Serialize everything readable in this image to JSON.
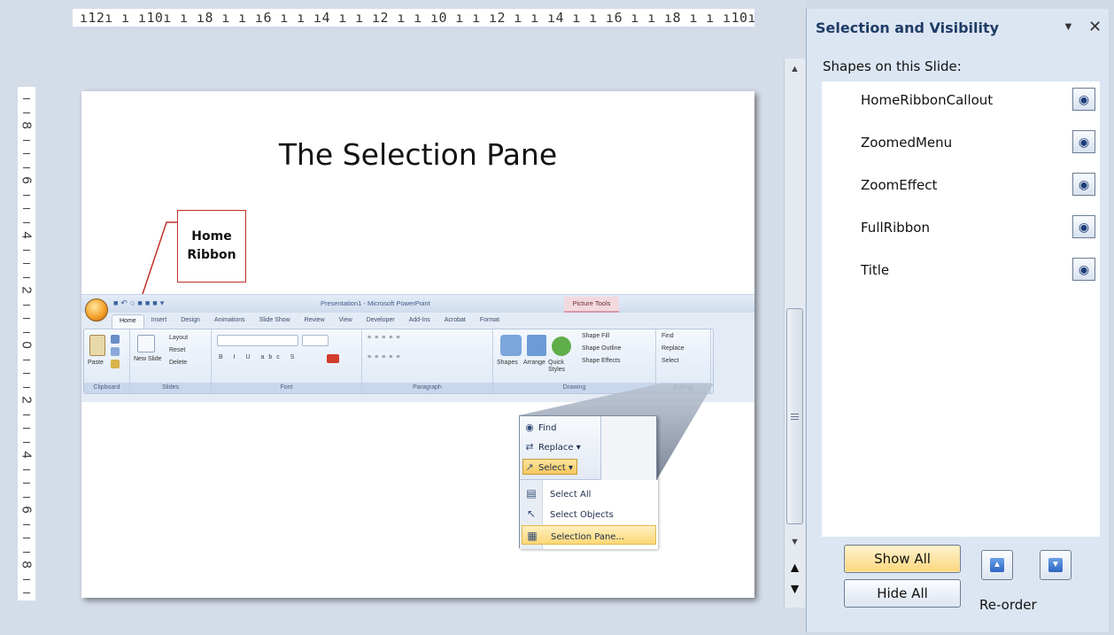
{
  "ruler": {
    "horizontal": "ı12ı ı ı10ı ı ı8 ı ı ı6 ı ı ı4 ı ı ı2 ı ı ı0 ı ı ı2 ı ı ı4 ı ı ı6 ı ı ı8 ı ı ı10ı ı ı12ı",
    "vertical_numbers": [
      "8",
      "6",
      "4",
      "2",
      "0",
      "2",
      "4",
      "6",
      "8"
    ]
  },
  "slide": {
    "title": "The Selection Pane",
    "callout": "Home Ribbon"
  },
  "ribbon": {
    "app_title": "Presentation1 - Microsoft PowerPoint",
    "contextual_tab": "Picture Tools",
    "tabs": [
      "Home",
      "Insert",
      "Design",
      "Animations",
      "Slide Show",
      "Review",
      "View",
      "Developer",
      "Add-Ins",
      "Acrobat",
      "Format"
    ],
    "groups": [
      "Clipboard",
      "Slides",
      "Font",
      "Paragraph",
      "Drawing",
      "Editing"
    ],
    "paste": "Paste",
    "new_slide": "New Slide",
    "layout": "Layout",
    "reset": "Reset",
    "delete": "Delete",
    "shapes": "Shapes",
    "arrange": "Arrange",
    "quick_styles": "Quick Styles",
    "shape_fill": "Shape Fill",
    "shape_outline": "Shape Outline",
    "shape_effects": "Shape Effects",
    "find": "Find",
    "replace": "Replace",
    "select": "Select"
  },
  "zoomed_menu": {
    "find": "Find",
    "replace": "Replace",
    "select": "Select",
    "select_all": "Select All",
    "select_objects": "Select Objects",
    "selection_pane": "Selection Pane..."
  },
  "pane": {
    "title": "Selection and Visibility",
    "subtitle": "Shapes on this Slide:",
    "shapes": [
      {
        "name": "HomeRibbonCallout",
        "visible": true
      },
      {
        "name": "ZoomedMenu",
        "visible": true
      },
      {
        "name": "ZoomEffect",
        "visible": true
      },
      {
        "name": "FullRibbon",
        "visible": true
      },
      {
        "name": "Title",
        "visible": true
      }
    ],
    "show_all": "Show All",
    "hide_all": "Hide All",
    "reorder": "Re-order"
  },
  "colors": {
    "pane_title": "#1f3c66",
    "callout_border": "#c0302a",
    "show_all_fill": "#fcd77c"
  },
  "icons": {
    "visibility": "eye-icon",
    "move_up": "arrow-up-icon",
    "move_down": "arrow-down-icon",
    "close": "close-icon",
    "menu": "chevron-down-icon"
  }
}
